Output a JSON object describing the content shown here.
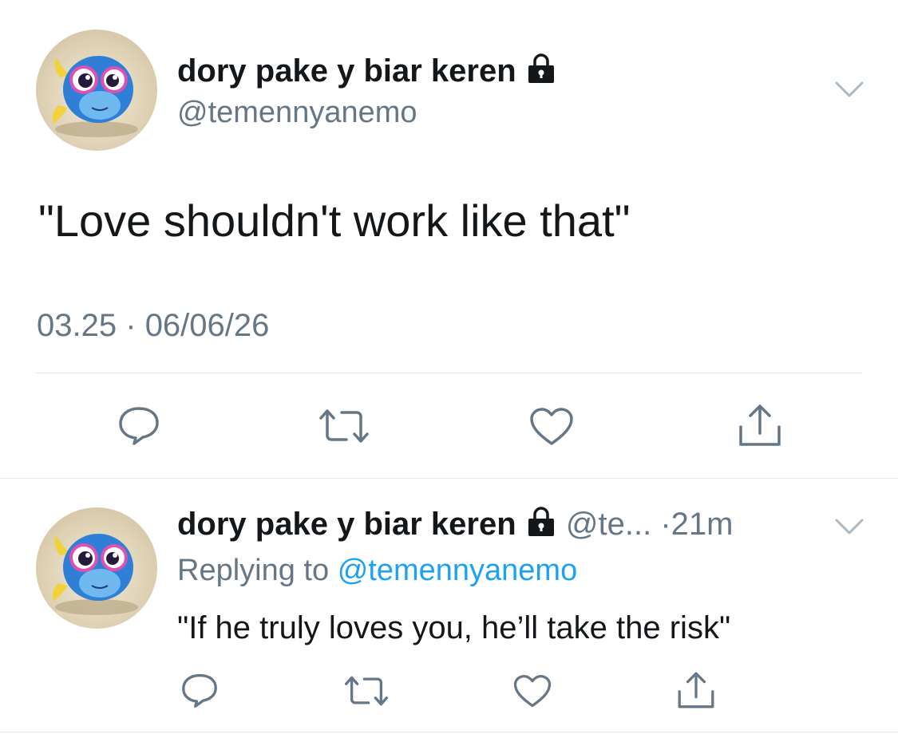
{
  "main_tweet": {
    "display_name": "dory pake y biar keren",
    "handle": "@temennyanemo",
    "text": "\"Love shouldn't work like that\"",
    "time": "03.25",
    "separator": "·",
    "date": "06/06/26",
    "protected_icon": "lock-icon",
    "menu_icon": "chevron-down-icon"
  },
  "actions": {
    "reply_icon": "reply-icon",
    "retweet_icon": "retweet-icon",
    "like_icon": "heart-icon",
    "share_icon": "share-icon"
  },
  "reply_tweet": {
    "display_name": "dory pake y biar keren",
    "handle_truncated": "@te...",
    "separator": "·",
    "time_ago": "21m",
    "replying_prefix": "Replying to",
    "replying_handle": "@temennyanemo",
    "text": "\"If he truly loves you, he’ll take the risk\""
  },
  "colors": {
    "text_primary": "#14171a",
    "text_secondary": "#657786",
    "accent": "#1da1f2",
    "icon_gray": "#657786",
    "divider": "#e1e8ed"
  }
}
